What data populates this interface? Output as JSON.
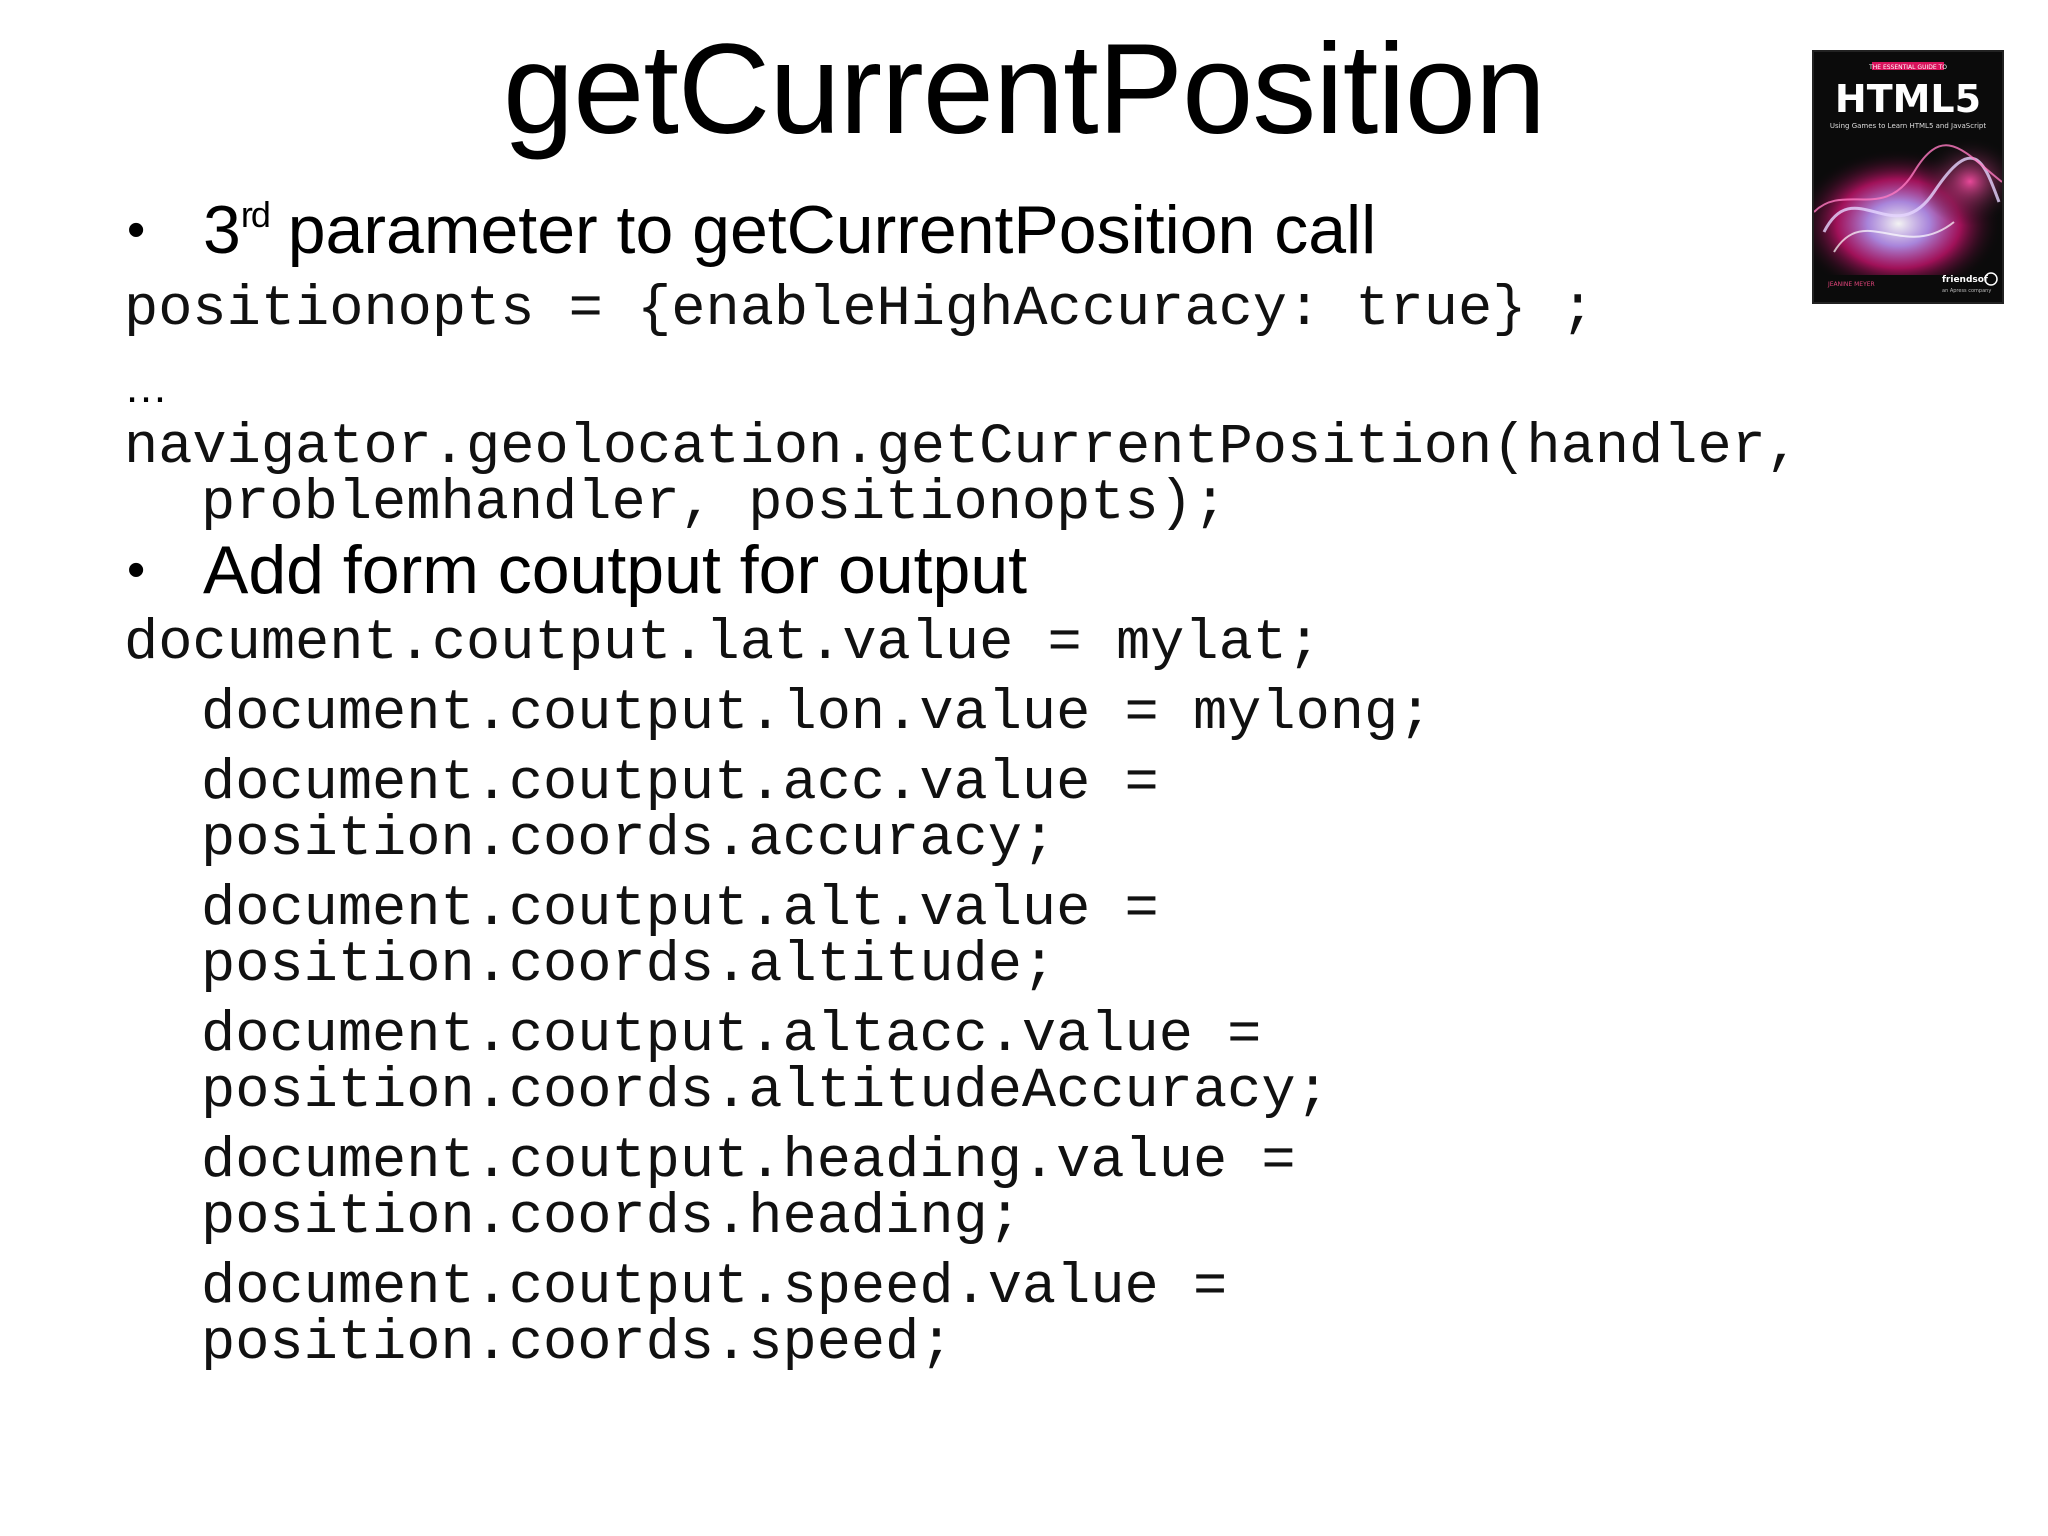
{
  "slide": {
    "title": "getCurrentPosition",
    "bullet1": {
      "pre": "3",
      "sup": "rd",
      "post": " parameter to getCurrentPosition call"
    },
    "code1": [
      "positionopts = {enableHighAccuracy: true} ;",
      "…",
      "navigator.geolocation.getCurrentPosition(handler,",
      "problemhandler, positionopts);"
    ],
    "bullet2": "Add form coutput for output",
    "code2": [
      "document.coutput.lat.value = mylat;",
      "document.coutput.lon.value = mylong;",
      "document.coutput.acc.value =",
      "position.coords.accuracy;",
      "document.coutput.alt.value =",
      "position.coords.altitude;",
      "document.coutput.altacc.value =",
      "position.coords.altitudeAccuracy;",
      "document.coutput.heading.value =",
      "position.coords.heading;",
      "document.coutput.speed.value =",
      "position.coords.speed;"
    ],
    "book": {
      "banner": "THE ESSENTIAL GUIDE TO",
      "title": "HTML5",
      "subtitle": "Using Games to Learn HTML5 and JavaScript",
      "author": "JEANINE MEYER",
      "publisher": "friendsof",
      "tagline": "an Apress company"
    },
    "colors": {
      "text": "#000000",
      "code": "#111111",
      "book_bg": "#0b0b0b",
      "book_banner": "#d8125b"
    }
  }
}
